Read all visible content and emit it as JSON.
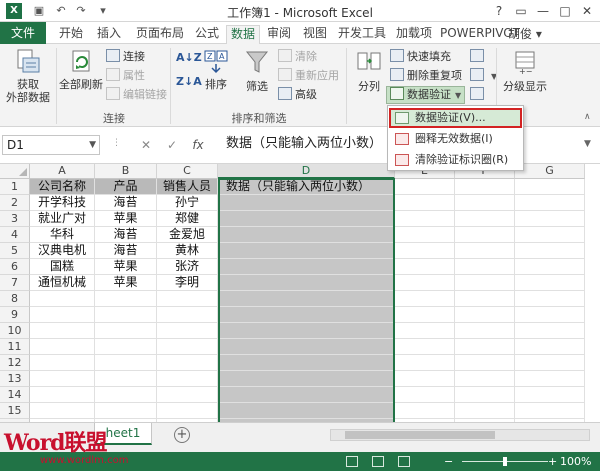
{
  "titlebar": {
    "app_logo": "X",
    "title": "工作簿1 - Microsoft Excel",
    "qat_icons": [
      "save-icon",
      "undo-icon",
      "redo-icon",
      "customize-icon"
    ],
    "help": "?",
    "minimize": "—",
    "restore": "□",
    "close": "✕"
  },
  "tabs": {
    "file": "文件",
    "items": [
      "开始",
      "插入",
      "页面布局",
      "公式",
      "数据",
      "审阅",
      "视图",
      "开发工具",
      "加载项",
      "POWERPIVOT"
    ],
    "active": "数据",
    "user": "胡俊 ▾"
  },
  "ribbon": {
    "get_external": "获取\n外部数据",
    "refresh_all": "全部刷新",
    "connections": "连接",
    "properties": "属性",
    "edit_links": "编辑链接",
    "group_connections": "连接",
    "sort": "排序",
    "filter": "筛选",
    "clear": "清除",
    "reapply": "重新应用",
    "advanced": "高级",
    "group_sort_filter": "排序和筛选",
    "text_to_columns": "分列",
    "flash_fill": "快速填充",
    "remove_duplicates": "删除重复项",
    "data_validation": "数据验证",
    "outline": "分级显示"
  },
  "dropdown": {
    "items": [
      "数据验证(V)...",
      "圈释无效数据(I)",
      "清除验证标识圈(R)"
    ]
  },
  "formula_bar": {
    "name_box": "D1",
    "cancel": "✕",
    "enter": "✓",
    "fx": "fx",
    "content": "数据（只能输入两位小数）"
  },
  "sheet": {
    "columns": [
      "A",
      "B",
      "C",
      "D",
      "E",
      "F",
      "G"
    ],
    "rows": [
      "1",
      "2",
      "3",
      "4",
      "5",
      "6",
      "7",
      "8",
      "9",
      "10",
      "11",
      "12",
      "13",
      "14",
      "15"
    ],
    "cells": [
      [
        "公司名称",
        "产品",
        "销售人员",
        "数据（只能输入两位小数）"
      ],
      [
        "开学科技",
        "海苔",
        "孙宁",
        ""
      ],
      [
        "就业广对",
        "苹果",
        "郑健",
        ""
      ],
      [
        "华科",
        "海苔",
        "金爱旭",
        ""
      ],
      [
        "汉典电机",
        "海苔",
        "黄林",
        ""
      ],
      [
        "国糕",
        "苹果",
        "张济",
        ""
      ],
      [
        "通恒机械",
        "苹果",
        "李明",
        ""
      ]
    ]
  },
  "sheet_tabs": {
    "tab": "heet1",
    "add": "+"
  },
  "watermark": {
    "logo": "Word联盟",
    "url": "www.wordlm.com"
  },
  "status": {
    "zoom": "100%",
    "minus": "−",
    "plus": "+"
  },
  "colors": {
    "accent": "#217346",
    "highlight_red": "#d32323"
  }
}
